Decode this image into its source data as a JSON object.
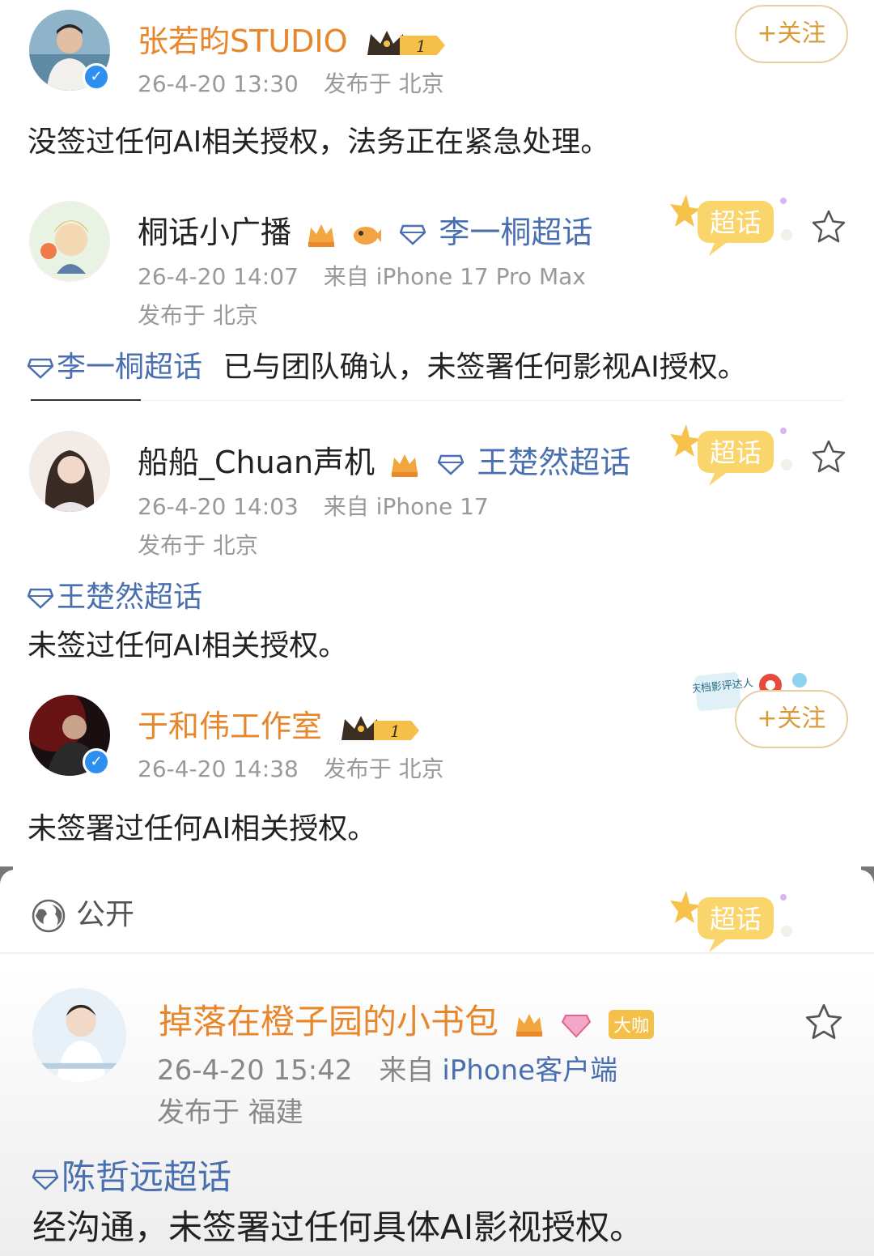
{
  "posts": [
    {
      "author": "张若昀STUDIO",
      "time": "26-4-20 13:30",
      "location": "发布于 北京",
      "follow": "+关注",
      "text": "没签过任何AI相关授权，法务正在紧急处理。",
      "level": "1"
    },
    {
      "author": "桐话小广播",
      "topic_tag": "李一桐超话",
      "time": "26-4-20 14:07",
      "source": "来自 iPhone 17 Pro Max",
      "location": "发布于 北京",
      "topic": "李一桐超话",
      "text": "已与团队确认，未签署任何影视AI授权。",
      "badge": "超话"
    },
    {
      "author": "船船_Chuan声机",
      "topic_tag": "王楚然超话",
      "time": "26-4-20 14:03",
      "source": "来自 iPhone 17",
      "location": "发布于 北京",
      "topic": "王楚然超话",
      "text": "未签过任何AI相关授权。",
      "badge": "超话"
    },
    {
      "author": "于和伟工作室",
      "time": "26-4-20 14:38",
      "location": "发布于 北京",
      "follow": "+关注",
      "text": "未签署过任何AI相关授权。",
      "level": "1",
      "badge_text": "国庆档影评达人"
    }
  ],
  "sheet": {
    "visibility": "公开",
    "badge": "超话"
  },
  "last_post": {
    "author": "掉落在橙子园的小书包",
    "tag": "大咖",
    "time": "26-4-20 15:42",
    "source_prefix": "来自",
    "source": "iPhone客户端",
    "location": "发布于 福建",
    "topic": "陈哲远超话",
    "text": "经沟通，未签署过任何具体AI影视授权。"
  },
  "colors": {
    "orange_name": "#e8862c",
    "topic_blue": "#4a6fb0",
    "meta_gray": "#999999",
    "verified_blue": "#2e8ff0",
    "gold": "#f5c04a"
  }
}
